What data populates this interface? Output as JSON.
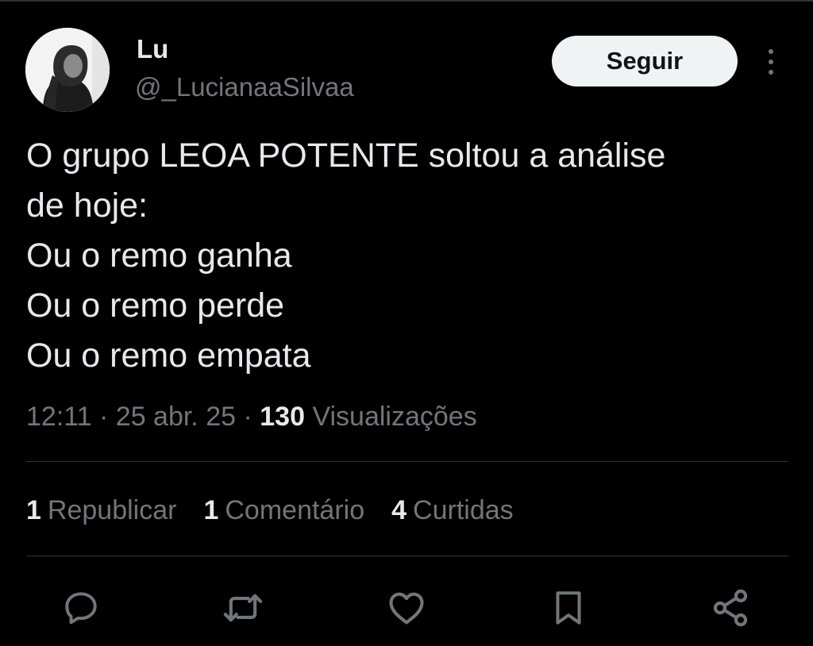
{
  "author": {
    "display_name": "Lu",
    "handle": "@_LucianaaSilvaa"
  },
  "follow_button": {
    "label": "Seguir"
  },
  "more_icon": "more-vertical-icon",
  "tweet": {
    "text": "O grupo LEOA POTENTE soltou a análise\nde hoje:\nOu o remo ganha\nOu o remo perde\nOu o remo empata"
  },
  "meta": {
    "time": "12:11",
    "separator": " · ",
    "date": "25 abr. 25",
    "views_count": "130",
    "views_label": "Visualizações"
  },
  "stats": [
    {
      "count": "1",
      "label": "Republicar"
    },
    {
      "count": "1",
      "label": "Comentário"
    },
    {
      "count": "4",
      "label": "Curtidas"
    }
  ],
  "actions": [
    {
      "icon": "reply-icon"
    },
    {
      "icon": "retweet-icon"
    },
    {
      "icon": "like-icon"
    },
    {
      "icon": "bookmark-icon"
    },
    {
      "icon": "share-icon"
    }
  ],
  "colors": {
    "background": "#000000",
    "text_primary": "#e7e9ea",
    "text_secondary": "#71767b",
    "divider": "#2f3336",
    "button_bg": "#eff3f4"
  }
}
